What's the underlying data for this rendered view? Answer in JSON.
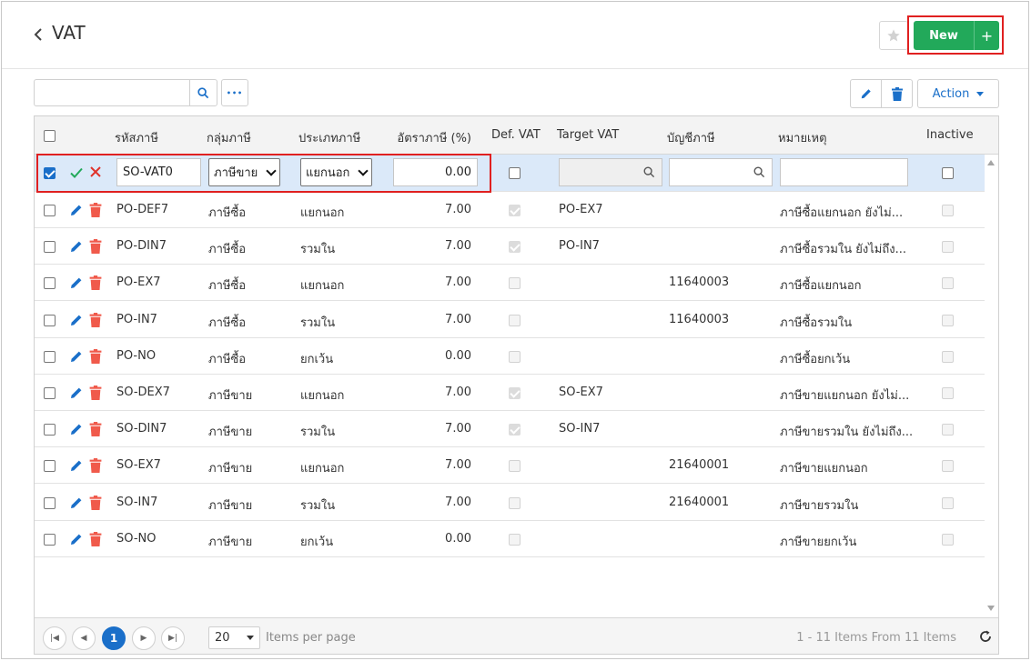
{
  "header": {
    "title": "VAT",
    "new_label": "New",
    "new_plus": "+"
  },
  "toolbar": {
    "search_value": "",
    "more_label": "•••",
    "action_label": "Action"
  },
  "columns": {
    "code": "รหัสภาษี",
    "group": "กลุ่มภาษี",
    "type": "ประเภทภาษี",
    "rate": "อัตราภาษี (%)",
    "def_vat": "Def. VAT",
    "target_vat": "Target VAT",
    "account": "บัญชีภาษี",
    "remark": "หมายเหตุ",
    "inactive": "Inactive"
  },
  "edit_row": {
    "code": "SO-VAT0",
    "group": "ภาษีขาย",
    "type": "แยกนอก",
    "rate": "0.00",
    "target_vat": "",
    "account": "",
    "remark": "",
    "selected": true
  },
  "rows": [
    {
      "code": "PO-DEF7",
      "group": "ภาษีซื้อ",
      "type": "แยกนอก",
      "rate": "7.00",
      "def_vat": true,
      "target_vat": "PO-EX7",
      "account": "",
      "remark": "ภาษีซื้อแยกนอก ยังไม่...",
      "inactive": false
    },
    {
      "code": "PO-DIN7",
      "group": "ภาษีซื้อ",
      "type": "รวมใน",
      "rate": "7.00",
      "def_vat": true,
      "target_vat": "PO-IN7",
      "account": "",
      "remark": "ภาษีซื้อรวมใน ยังไม่ถึง...",
      "inactive": false
    },
    {
      "code": "PO-EX7",
      "group": "ภาษีซื้อ",
      "type": "แยกนอก",
      "rate": "7.00",
      "def_vat": false,
      "target_vat": "",
      "account": "11640003",
      "remark": "ภาษีซื้อแยกนอก",
      "inactive": false
    },
    {
      "code": "PO-IN7",
      "group": "ภาษีซื้อ",
      "type": "รวมใน",
      "rate": "7.00",
      "def_vat": false,
      "target_vat": "",
      "account": "11640003",
      "remark": "ภาษีซื้อรวมใน",
      "inactive": false
    },
    {
      "code": "PO-NO",
      "group": "ภาษีซื้อ",
      "type": "ยกเว้น",
      "rate": "0.00",
      "def_vat": false,
      "target_vat": "",
      "account": "",
      "remark": "ภาษีซื้อยกเว้น",
      "inactive": false
    },
    {
      "code": "SO-DEX7",
      "group": "ภาษีขาย",
      "type": "แยกนอก",
      "rate": "7.00",
      "def_vat": true,
      "target_vat": "SO-EX7",
      "account": "",
      "remark": "ภาษีขายแยกนอก ยังไม่...",
      "inactive": false
    },
    {
      "code": "SO-DIN7",
      "group": "ภาษีขาย",
      "type": "รวมใน",
      "rate": "7.00",
      "def_vat": true,
      "target_vat": "SO-IN7",
      "account": "",
      "remark": "ภาษีขายรวมใน ยังไม่ถึง...",
      "inactive": false
    },
    {
      "code": "SO-EX7",
      "group": "ภาษีขาย",
      "type": "แยกนอก",
      "rate": "7.00",
      "def_vat": false,
      "target_vat": "",
      "account": "21640001",
      "remark": "ภาษีขายแยกนอก",
      "inactive": false
    },
    {
      "code": "SO-IN7",
      "group": "ภาษีขาย",
      "type": "รวมใน",
      "rate": "7.00",
      "def_vat": false,
      "target_vat": "",
      "account": "21640001",
      "remark": "ภาษีขายรวมใน",
      "inactive": false
    },
    {
      "code": "SO-NO",
      "group": "ภาษีขาย",
      "type": "ยกเว้น",
      "rate": "0.00",
      "def_vat": false,
      "target_vat": "",
      "account": "",
      "remark": "ภาษีขายยกเว้น",
      "inactive": false
    }
  ],
  "pager": {
    "current_page": "1",
    "page_size": "20",
    "items_per_page_label": "Items per page",
    "info": "1 - 11 Items From 11 Items"
  },
  "colors": {
    "primary": "#1a6fc9",
    "new_button": "#22a95a",
    "delete": "#f05a4b",
    "highlight": "#e02020",
    "editing_row": "#dbe9f9"
  },
  "icons": [
    "chevron-left-icon",
    "star-icon",
    "search-icon",
    "more-icon",
    "pencil-icon",
    "trash-icon",
    "check-icon",
    "close-icon",
    "refresh-icon"
  ]
}
